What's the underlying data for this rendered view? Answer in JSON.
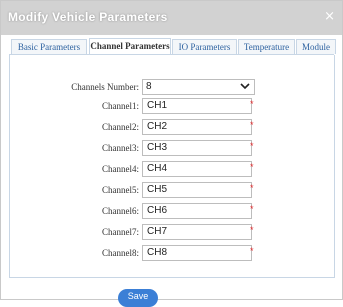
{
  "dialog": {
    "title": "Modify Vehicle Parameters",
    "close_glyph": "×"
  },
  "tabs": [
    {
      "label": "Basic Parameters",
      "active": false
    },
    {
      "label": "Channel Parameters",
      "active": true
    },
    {
      "label": "IO Parameters",
      "active": false
    },
    {
      "label": "Temperature",
      "active": false
    },
    {
      "label": "Module",
      "active": false
    }
  ],
  "channels_number": {
    "label": "Channels Number:",
    "value": "8"
  },
  "channels": [
    {
      "label": "Channel1:",
      "value": "CH1"
    },
    {
      "label": "Channel2:",
      "value": "CH2"
    },
    {
      "label": "Channel3:",
      "value": "CH3"
    },
    {
      "label": "Channel4:",
      "value": "CH4"
    },
    {
      "label": "Channel5:",
      "value": "CH5"
    },
    {
      "label": "Channel6:",
      "value": "CH6"
    },
    {
      "label": "Channel7:",
      "value": "CH7"
    },
    {
      "label": "Channel8:",
      "value": "CH8"
    }
  ],
  "required_marker": "*",
  "save_label": "Save",
  "colors": {
    "accent": "#3b7fd6",
    "required": "#e0292c",
    "titlebar": "#d2d2d2"
  }
}
